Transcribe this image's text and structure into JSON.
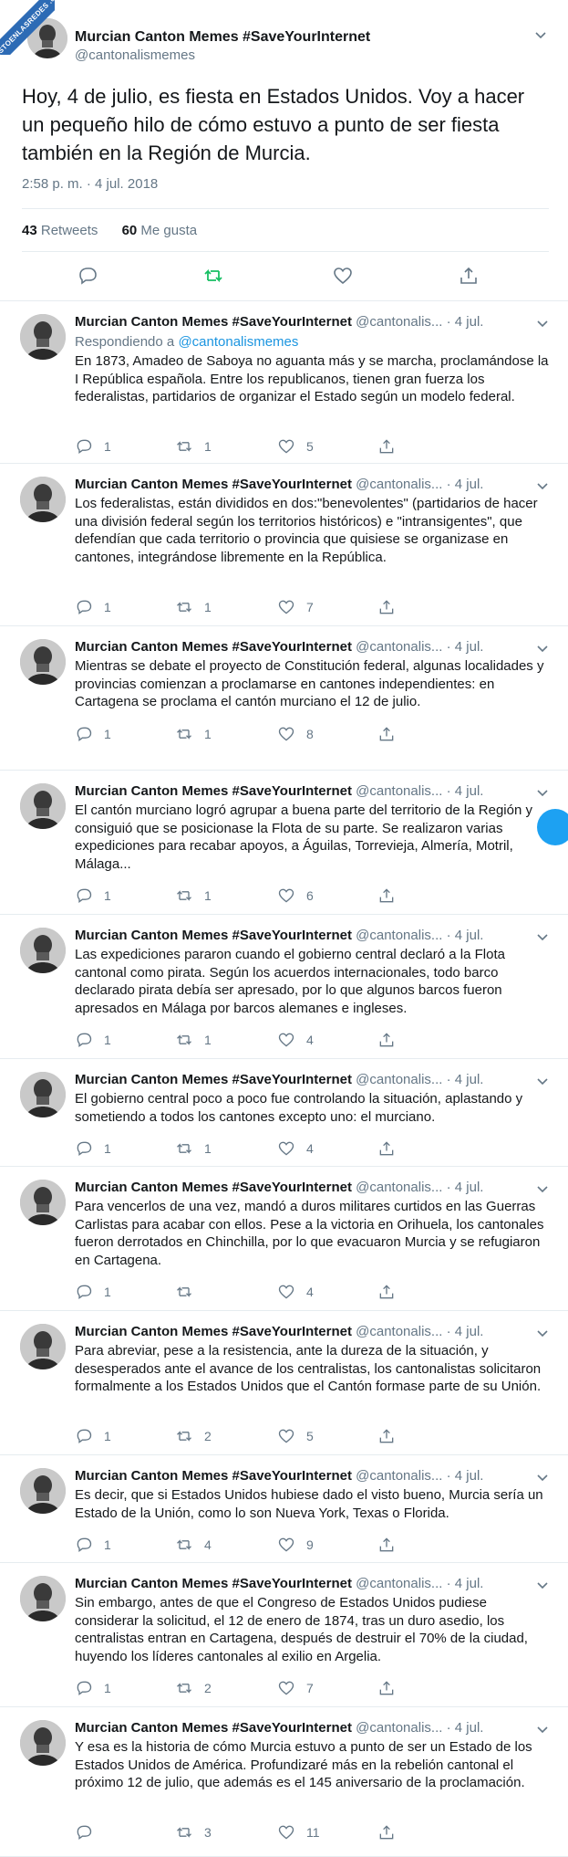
{
  "watermark": {
    "text": "VISTOENLASREDES .com"
  },
  "main_tweet": {
    "author_name": "Murcian Canton Memes #SaveYourInternet",
    "handle": "@cantonalismemes",
    "text": "Hoy, 4 de julio, es fiesta en Estados Unidos. Voy a hacer un pequeño hilo de cómo estuvo a punto de ser fiesta también en la Región de Murcia.",
    "timestamp": "2:58 p. m. · 4 jul. 2018",
    "retweets_count": "43",
    "retweets_label": "Retweets",
    "likes_count": "60",
    "likes_label": "Me gusta",
    "icons": [
      "reply-icon",
      "retweet-icon",
      "like-icon",
      "share-icon",
      "chevron-down-icon"
    ],
    "retweet_active_color": "#17bf63"
  },
  "replies": [
    {
      "author_name": "Murcian Canton Memes #SaveYourInternet",
      "handle": "@cantonalis...",
      "date": "· 4 jul.",
      "replying_prefix": "Respondiendo a",
      "replying_to": "@cantonalismemes",
      "text": "En 1873, Amadeo de Saboya no aguanta más y se marcha, proclamándose la I República española. Entre los republicanos, tienen gran fuerza los federalistas, partidarios de organizar el Estado según un modelo federal.",
      "replies": "1",
      "retweets": "1",
      "likes": "5"
    },
    {
      "author_name": "Murcian Canton Memes #SaveYourInternet",
      "handle": "@cantonalis...",
      "date": "· 4 jul.",
      "text": "Los federalistas, están divididos en dos:\"benevolentes\" (partidarios de hacer una división federal según los territorios históricos) e \"intransigentes\", que defendían que cada territorio o provincia que quisiese se organizase en cantones, integrándose libremente en la República.",
      "replies": "1",
      "retweets": "1",
      "likes": "7"
    },
    {
      "author_name": "Murcian Canton Memes #SaveYourInternet",
      "handle": "@cantonalis...",
      "date": "· 4 jul.",
      "text": "Mientras se debate el proyecto de Constitución federal, algunas localidades y provincias comienzan a proclamarse en cantones independientes: en Cartagena se proclama el cantón murciano el 12 de julio.",
      "replies": "1",
      "retweets": "1",
      "likes": "8"
    },
    {
      "author_name": "Murcian Canton Memes #SaveYourInternet",
      "handle": "@cantonalis...",
      "date": "· 4 jul.",
      "text": "El cantón murciano logró agrupar a buena parte del territorio de la Región y consiguió que se posicionase la Flota de su parte. Se realizaron varias expediciones para recabar apoyos, a Águilas, Torrevieja, Almería, Motril, Málaga...",
      "replies": "1",
      "retweets": "1",
      "likes": "6"
    },
    {
      "author_name": "Murcian Canton Memes #SaveYourInternet",
      "handle": "@cantonalis...",
      "date": "· 4 jul.",
      "text": "Las expediciones pararon cuando el gobierno central declaró a la Flota cantonal como pirata. Según los acuerdos internacionales, todo barco declarado pirata debía ser apresado, por lo que algunos barcos fueron apresados en Málaga por barcos alemanes e ingleses.",
      "replies": "1",
      "retweets": "1",
      "likes": "4"
    },
    {
      "author_name": "Murcian Canton Memes #SaveYourInternet",
      "handle": "@cantonalis...",
      "date": "· 4 jul.",
      "text": "El gobierno central poco a poco fue controlando la situación, aplastando y sometiendo a todos los cantones excepto uno: el murciano.",
      "replies": "1",
      "retweets": "1",
      "likes": "4"
    },
    {
      "author_name": "Murcian Canton Memes #SaveYourInternet",
      "handle": "@cantonalis...",
      "date": "· 4 jul.",
      "text": "Para vencerlos de una vez, mandó a duros militares curtidos en las Guerras Carlistas para acabar con ellos. Pese a la victoria en Orihuela, los cantonales fueron derrotados en Chinchilla, por lo que evacuaron Murcia y se refugiaron en Cartagena.",
      "replies": "1",
      "retweets": "",
      "likes": "4"
    },
    {
      "author_name": "Murcian Canton Memes #SaveYourInternet",
      "handle": "@cantonalis...",
      "date": "· 4 jul.",
      "text": "Para abreviar, pese a la resistencia, ante la dureza de la situación, y desesperados ante el avance de los centralistas, los cantonalistas solicitaron formalmente a los Estados Unidos que el Cantón formase parte de su Unión.",
      "replies": "1",
      "retweets": "2",
      "likes": "5"
    },
    {
      "author_name": "Murcian Canton Memes #SaveYourInternet",
      "handle": "@cantonalis...",
      "date": "· 4 jul.",
      "text": "Es decir, que si Estados Unidos hubiese dado el visto bueno, Murcia sería un Estado de la Unión, como lo son Nueva York, Texas o Florida.",
      "replies": "1",
      "retweets": "4",
      "likes": "9"
    },
    {
      "author_name": "Murcian Canton Memes #SaveYourInternet",
      "handle": "@cantonalis...",
      "date": "· 4 jul.",
      "text": "Sin embargo, antes de que el Congreso de Estados Unidos pudiese considerar la solicitud, el 12 de enero de 1874, tras un duro asedio, los centralistas entran en Cartagena, después de destruir el 70% de la ciudad, huyendo los líderes cantonales al exilio en Argelia.",
      "replies": "1",
      "retweets": "2",
      "likes": "7"
    },
    {
      "author_name": "Murcian Canton Memes #SaveYourInternet",
      "handle": "@cantonalis...",
      "date": "· 4 jul.",
      "text": "Y esa es la historia de cómo Murcia estuvo a punto de ser un Estado de los Estados Unidos de América. Profundizaré más en la rebelión cantonal el próximo 12 de julio, que además es el 145 aniversario de la proclamación.",
      "replies": "",
      "retweets": "3",
      "likes": "11"
    }
  ]
}
